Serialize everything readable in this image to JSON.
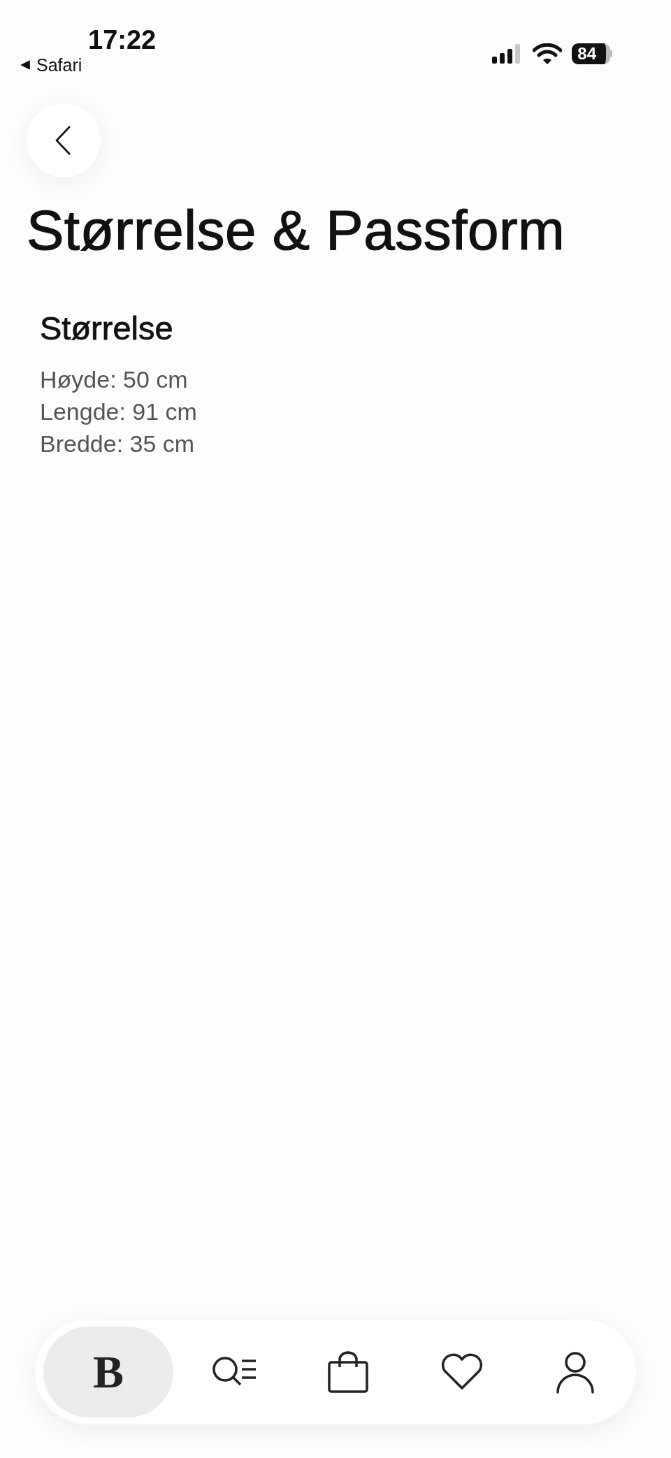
{
  "status_bar": {
    "time": "17:22",
    "back_app": "Safari",
    "battery": "84"
  },
  "title": "Størrelse & Passform",
  "section": {
    "heading": "Størrelse",
    "lines": [
      "Høyde: 50 cm",
      "Lengde: 91 cm",
      "Bredde: 35 cm"
    ]
  },
  "tab_bar": [
    {
      "kind": "logo",
      "label": "B",
      "selected": true
    },
    {
      "kind": "search",
      "selected": false
    },
    {
      "kind": "bag",
      "selected": false
    },
    {
      "kind": "heart",
      "selected": false
    },
    {
      "kind": "profile",
      "selected": false
    }
  ]
}
